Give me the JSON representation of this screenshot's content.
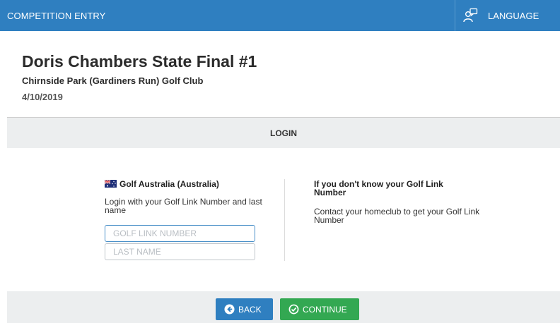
{
  "header": {
    "title": "COMPETITION ENTRY",
    "language_label": "LANGUAGE",
    "language_icon": "language-person-icon"
  },
  "event": {
    "name": "Doris Chambers State Final #1",
    "club": "Chirnside Park (Gardiners Run) Golf Club",
    "date": "4/10/2019"
  },
  "section": {
    "label": "LOGIN"
  },
  "login": {
    "organisation": "Golf Australia (Australia)",
    "flag_icon": "australia-flag-icon",
    "instructions": "Login with your Golf Link Number and last name",
    "golf_link": {
      "placeholder": "GOLF LINK NUMBER",
      "value": ""
    },
    "last_name": {
      "placeholder": "LAST NAME",
      "value": ""
    }
  },
  "help": {
    "title": "If you don't know your Golf Link Number",
    "text": "Contact your homeclub to get your Golf Link Number"
  },
  "footer": {
    "back_label": "BACK",
    "continue_label": "CONTINUE"
  },
  "colors": {
    "header_bg": "#2f7fc0",
    "back_button": "#2f7fc0",
    "continue_button": "#33a852",
    "section_bg": "#eceeef"
  }
}
